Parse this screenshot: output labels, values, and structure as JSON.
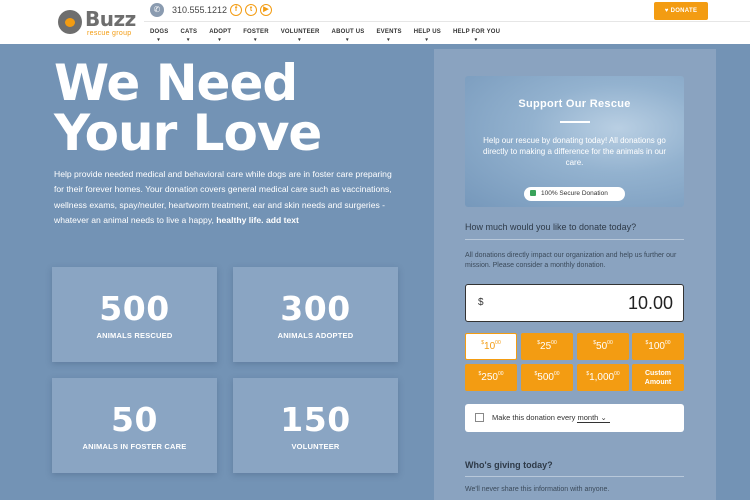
{
  "header": {
    "logo_text": "Buzz",
    "logo_sub": "rescue group",
    "phone": "310.555.1212",
    "socials": [
      {
        "name": "facebook",
        "glyph": "f"
      },
      {
        "name": "twitter",
        "glyph": "t"
      },
      {
        "name": "youtube",
        "glyph": "▶"
      }
    ],
    "donate_label": "DONATE",
    "nav": [
      "DOGS",
      "CATS",
      "ADOPT",
      "FOSTER",
      "VOLUNTEER",
      "ABOUT US",
      "EVENTS",
      "HELP US",
      "HELP FOR YOU"
    ]
  },
  "hero": {
    "title_line1": "We Need",
    "title_line2": "Your Love",
    "body": "Help provide needed medical and behavioral care while dogs are in foster care preparing for their forever homes.  Your donation covers general medical care such as vaccinations, wellness exams, spay/neuter, heartworm treatment, ear and skin needs and surgeries - whatever an animal needs to live a happy,",
    "body_bold": "healthy life. add text"
  },
  "stats": [
    {
      "num": "500",
      "label": "ANIMALS RESCUED"
    },
    {
      "num": "300",
      "label": "ANIMALS ADOPTED"
    },
    {
      "num": "50",
      "label": "ANIMALS IN FOSTER CARE"
    },
    {
      "num": "150",
      "label": "VOLUNTEER"
    }
  ],
  "donation": {
    "hero_title": "Support Our Rescue",
    "hero_text": "Help our rescue by donating today! All donations go directly to making a difference for the animals in our care.",
    "secure_label": "100% Secure Donation",
    "question": "How much would you like to donate today?",
    "description": "All donations directly impact our organization and help us further our mission. Please consider a monthly donation.",
    "currency": "$",
    "amount": "10.00",
    "amounts": [
      {
        "cur": "$",
        "whole": "10",
        "cents": "00",
        "selected": true
      },
      {
        "cur": "$",
        "whole": "25",
        "cents": "00",
        "selected": false
      },
      {
        "cur": "$",
        "whole": "50",
        "cents": "00",
        "selected": false
      },
      {
        "cur": "$",
        "whole": "100",
        "cents": "00",
        "selected": false
      },
      {
        "cur": "$",
        "whole": "250",
        "cents": "00",
        "selected": false
      },
      {
        "cur": "$",
        "whole": "500",
        "cents": "00",
        "selected": false
      },
      {
        "cur": "$",
        "whole": "1,000",
        "cents": "00",
        "selected": false
      }
    ],
    "custom_label_line1": "Custom",
    "custom_label_line2": "Amount",
    "monthly_prefix": "Make this donation every",
    "monthly_value": "month",
    "who_heading": "Who's giving today?",
    "who_desc": "We'll never share this information with anyone."
  },
  "colors": {
    "accent": "#f39c12",
    "background": "#7393b5",
    "panel": "#8aa3c0"
  }
}
